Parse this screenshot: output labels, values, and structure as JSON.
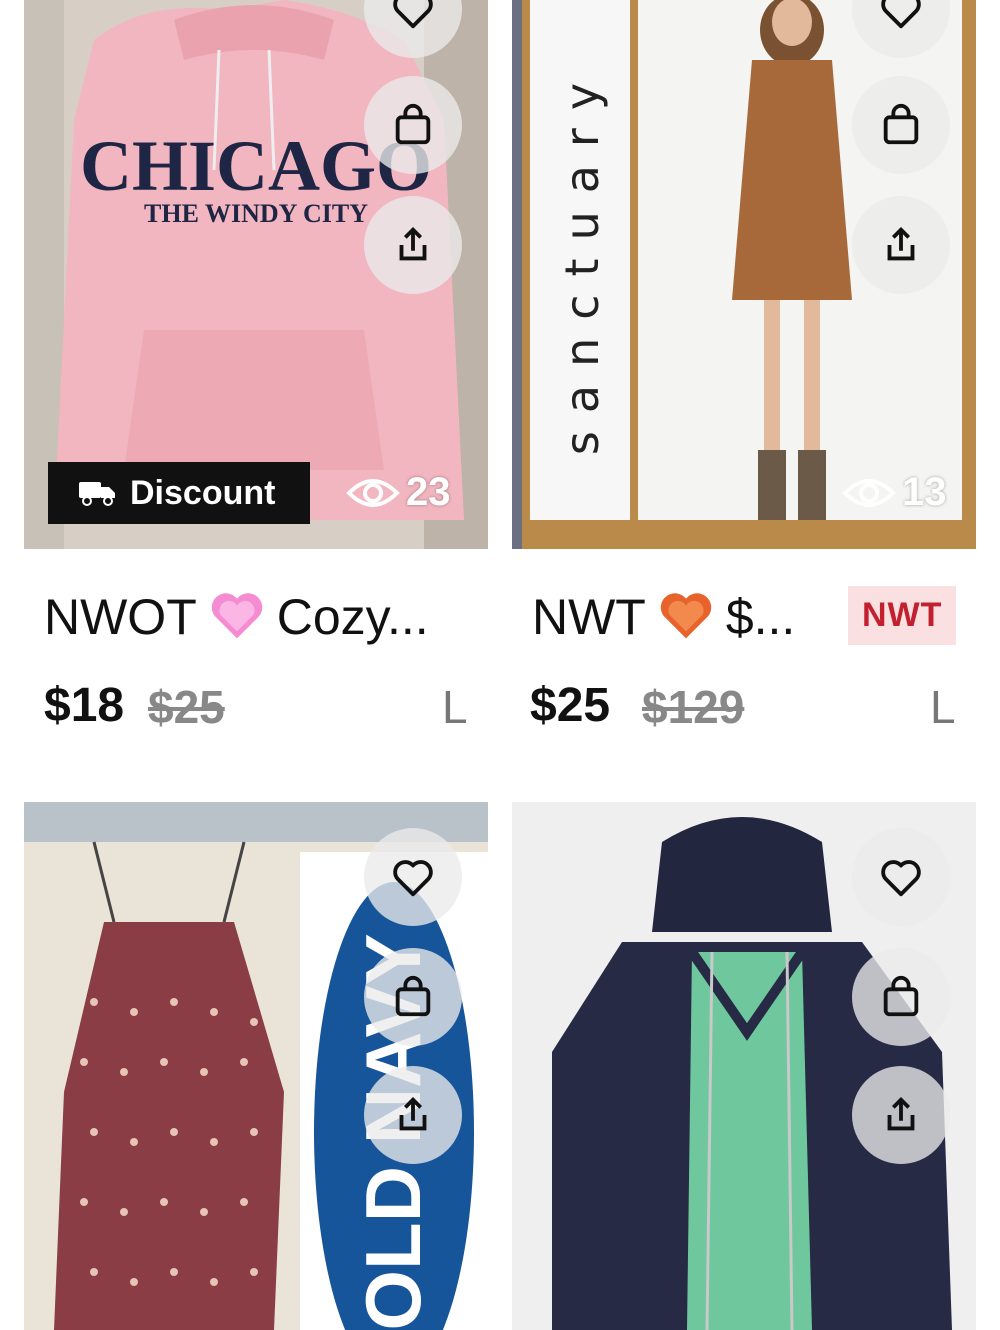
{
  "listings": [
    {
      "title": "NWOT",
      "title_tail": "Cozy...",
      "emoji": "pink-heart",
      "price": "$18",
      "original_price": "$25",
      "size": "L",
      "badge": "Discount",
      "views": "23",
      "print_line1": "CHICAGO",
      "print_line2": "THE WINDY CITY"
    },
    {
      "title": "NWT",
      "title_tail": "$...",
      "emoji": "orange-heart",
      "tag": "NWT",
      "price": "$25",
      "original_price": "$129",
      "size": "L",
      "views": "13",
      "brand_banner": "sanctuary"
    },
    {
      "brand_logo": "OLD NAVY"
    },
    {}
  ],
  "colors": {
    "accent_tag_bg": "#fbe0e2",
    "accent_tag_text": "#c2202f",
    "badge_bg": "#111111",
    "strike_price": "#888888"
  },
  "icons": [
    "heart-icon",
    "shopping-bag-icon",
    "share-icon",
    "truck-icon",
    "eye-icon"
  ]
}
